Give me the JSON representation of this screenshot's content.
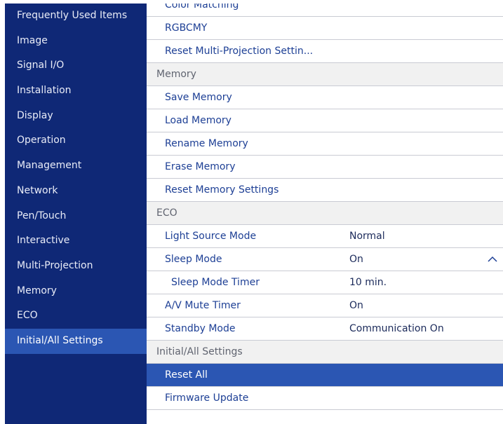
{
  "sidebar": {
    "items": [
      {
        "label": "Frequently Used Items"
      },
      {
        "label": "Image"
      },
      {
        "label": "Signal I/O"
      },
      {
        "label": "Installation"
      },
      {
        "label": "Display"
      },
      {
        "label": "Operation"
      },
      {
        "label": "Management"
      },
      {
        "label": "Network"
      },
      {
        "label": "Pen/Touch"
      },
      {
        "label": "Interactive"
      },
      {
        "label": "Multi-Projection"
      },
      {
        "label": "Memory"
      },
      {
        "label": "ECO"
      },
      {
        "label": "Initial/All Settings"
      }
    ],
    "active": "Initial/All Settings"
  },
  "main": {
    "rows": [
      {
        "label": "Color Matching",
        "value": ""
      },
      {
        "label": "RGBCMY",
        "value": ""
      },
      {
        "label": "Reset Multi-Projection Settin...",
        "value": ""
      },
      {
        "label": "Memory",
        "value": ""
      },
      {
        "label": "Save Memory",
        "value": ""
      },
      {
        "label": "Load Memory",
        "value": ""
      },
      {
        "label": "Rename Memory",
        "value": ""
      },
      {
        "label": "Erase Memory",
        "value": ""
      },
      {
        "label": "Reset Memory Settings",
        "value": ""
      },
      {
        "label": "ECO",
        "value": ""
      },
      {
        "label": "Light Source Mode",
        "value": "Normal"
      },
      {
        "label": "Sleep Mode",
        "value": "On"
      },
      {
        "label": "Sleep Mode Timer",
        "value": "10 min."
      },
      {
        "label": "A/V Mute Timer",
        "value": "On"
      },
      {
        "label": "Standby Mode",
        "value": "Communication On"
      },
      {
        "label": "Initial/All Settings",
        "value": ""
      },
      {
        "label": "Reset All",
        "value": ""
      },
      {
        "label": "Firmware Update",
        "value": ""
      }
    ],
    "selected": "Reset All"
  },
  "icons": {
    "sleep_mode_expand": "chevron-up-icon"
  },
  "colors": {
    "sidebar_bg": "#0f2876",
    "highlight": "#2b56b3",
    "item_text": "#1d3f95",
    "section_bg": "#f1f1f1"
  }
}
